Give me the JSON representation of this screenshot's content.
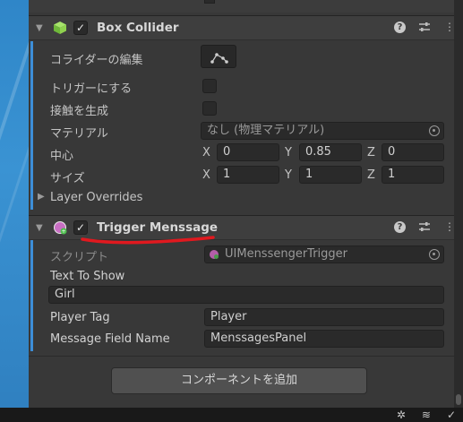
{
  "box_collider": {
    "title": "Box Collider",
    "enabled_mark": "✓",
    "edit_collider_label": "コライダーの編集",
    "is_trigger_label": "トリガーにする",
    "provides_contacts_label": "接触を生成",
    "material_label": "マテリアル",
    "material_value": "なし (物理マテリアル)",
    "center_label": "中心",
    "center": {
      "x_label": "X",
      "x": "0",
      "y_label": "Y",
      "y": "0.85",
      "z_label": "Z",
      "z": "0"
    },
    "size_label": "サイズ",
    "size": {
      "x_label": "X",
      "x": "1",
      "y_label": "Y",
      "y": "1",
      "z_label": "Z",
      "z": "1"
    },
    "layer_overrides_label": "Layer Overrides"
  },
  "trigger_message": {
    "title": "Trigger Menssage",
    "enabled_mark": "✓",
    "script_label": "スクリプト",
    "script_value": "UIMenssengerTrigger",
    "text_to_show_label": "Text To Show",
    "text_to_show_value": "Girl",
    "player_tag_label": "Player Tag",
    "player_tag_value": "Player",
    "message_field_label": "Message Field Name",
    "message_field_value": "MenssagesPanel"
  },
  "add_component_label": "コンポーネントを追加",
  "header_icons": {
    "help": "?",
    "presets": "sliders-icon",
    "menu": "⋮"
  },
  "colors": {
    "accent": "#3d8ed8",
    "annotation": "#e0191f",
    "scene_blue": "#2f86c8"
  }
}
